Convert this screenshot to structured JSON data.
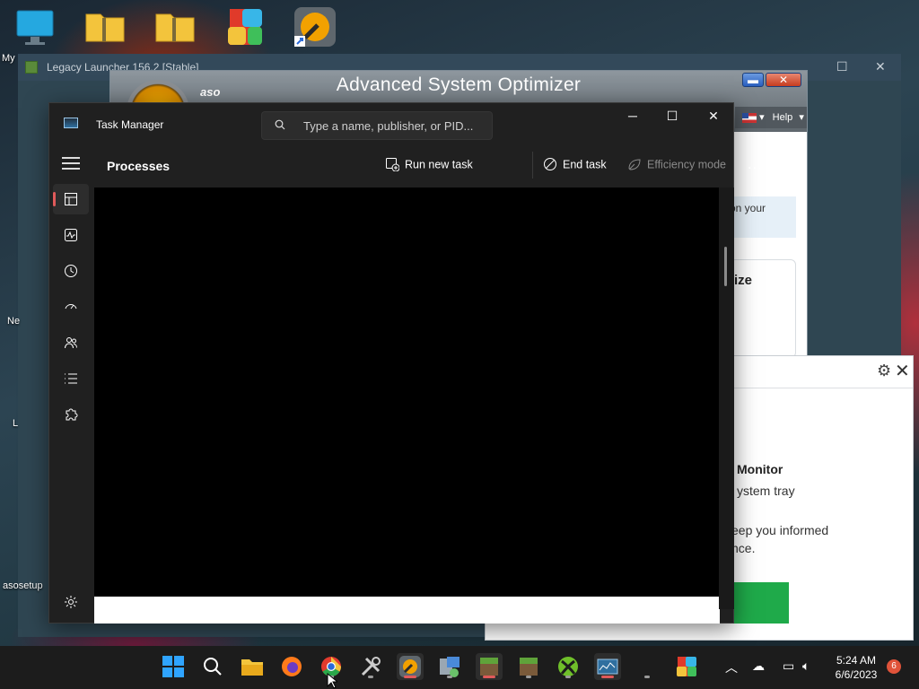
{
  "desktop": {
    "icons": [
      {
        "name": "This PC",
        "label": "My"
      },
      {
        "name": "folder-zip",
        "label": ""
      },
      {
        "name": "folder-zip-2",
        "label": ""
      },
      {
        "name": "office-app",
        "label": ""
      },
      {
        "name": "aso-shortcut",
        "label": ""
      }
    ],
    "left_labels": [
      "Ne",
      "L"
    ],
    "aso_setup_label": "asosetup"
  },
  "legacy_launcher": {
    "title": "Legacy Launcher 156.2 [Stable]"
  },
  "aso": {
    "title": "Advanced System Optimizer",
    "logo_text": "aso",
    "help_label": "Help",
    "info_text": "on your",
    "optimize_text": "ize"
  },
  "monitor_popup": {
    "title": "Monitor",
    "subtitle": "ystem tray",
    "para_line1": "eep you informed",
    "para_line2": "nce."
  },
  "task_manager": {
    "title": "Task Manager",
    "search_placeholder": "Type a name, publisher, or PID...",
    "section_title": "Processes",
    "commands": {
      "run_new_task": "Run new task",
      "end_task": "End task",
      "efficiency_mode": "Efficiency mode",
      "more": "..."
    },
    "nav": [
      "Processes",
      "Performance",
      "App history",
      "Startup apps",
      "Users",
      "Details",
      "Services"
    ]
  },
  "taskbar": {
    "apps": [
      "start",
      "search",
      "file-explorer",
      "firefox",
      "chrome",
      "tools",
      "aso",
      "network-app",
      "minecraft",
      "minecraft-2",
      "xbox-app",
      "task-manager",
      "blank",
      "office"
    ],
    "clock_time": "5:24 AM",
    "clock_date": "6/6/2023",
    "notification_count": "6"
  },
  "colors": {
    "tm_bg": "#202020",
    "accent_red": "#e05a5a",
    "aso_green": "#1faa4a"
  }
}
